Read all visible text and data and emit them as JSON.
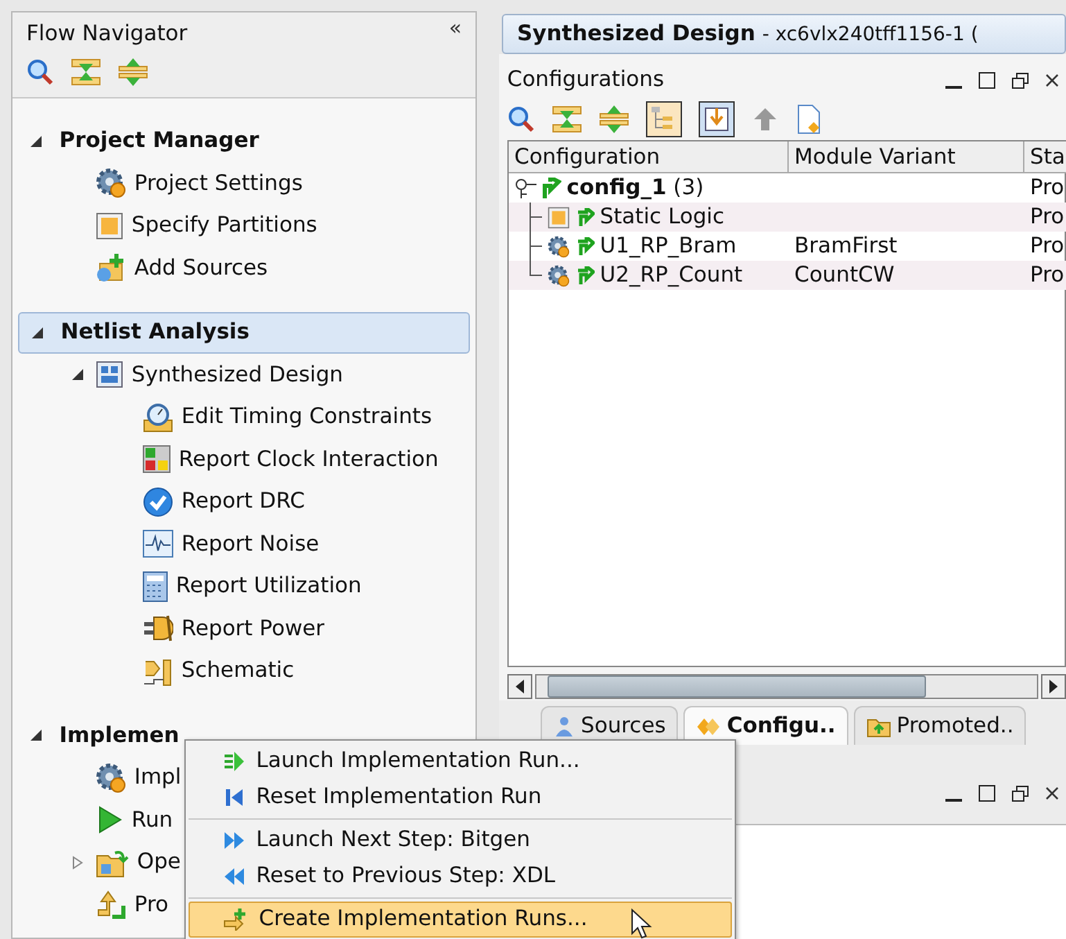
{
  "flow_navigator": {
    "title": "Flow Navigator",
    "collapse_label": "«",
    "sections": [
      {
        "label": "Project Manager",
        "selected": false,
        "expanded": true,
        "children": [
          {
            "label": "Project Settings"
          },
          {
            "label": "Specify Partitions"
          },
          {
            "label": "Add Sources"
          }
        ]
      },
      {
        "label": "Netlist Analysis",
        "selected": true,
        "expanded": true,
        "children": [
          {
            "label": "Synthesized Design",
            "expanded": true,
            "children": [
              {
                "label": "Edit Timing Constraints"
              },
              {
                "label": "Report Clock Interaction"
              },
              {
                "label": "Report DRC"
              },
              {
                "label": "Report Noise"
              },
              {
                "label": "Report Utilization"
              },
              {
                "label": "Report Power"
              },
              {
                "label": "Schematic"
              }
            ]
          }
        ]
      },
      {
        "label": "Implemen",
        "selected": false,
        "expanded": true,
        "children": [
          {
            "label": "Impl"
          },
          {
            "label": "Run"
          },
          {
            "label": "Ope",
            "expanded": false
          },
          {
            "label": "Pro"
          }
        ]
      }
    ]
  },
  "design_title": {
    "name": "Synthesized Design",
    "detail": "- xc6vlx240tff1156-1 ("
  },
  "configurations": {
    "title": "Configurations",
    "columns": [
      "Configuration",
      "Module Variant",
      "Sta"
    ],
    "rows": [
      {
        "configuration": "**config_1** (3)",
        "column_3": "Pro",
        "expanded": true,
        "children": [
          {
            "configuration": "Static Logic",
            "column_3": "Pro"
          },
          {
            "configuration": "U1_RP_Bram",
            "module_variant": "BramFirst",
            "column_3": "Pro"
          },
          {
            "configuration": "U2_RP_Count",
            "module_variant": "CountCW",
            "column_3": "Pro"
          }
        ]
      }
    ]
  },
  "tabs": [
    {
      "label": "Sources",
      "selected": false
    },
    {
      "label": "Configu..",
      "selected": true
    },
    {
      "label": "Promoted..",
      "selected": false
    }
  ],
  "context_menu": {
    "groups": [
      [
        {
          "label": "Launch Implementation Run...",
          "selected": false
        },
        {
          "label": "Reset Implementation Run",
          "selected": false
        }
      ],
      [
        {
          "label": "Launch Next Step: Bitgen",
          "selected": false
        },
        {
          "label": "Reset to Previous Step: XDL",
          "selected": false
        }
      ],
      [
        {
          "label": "Create Implementation Runs...",
          "selected": true
        }
      ]
    ]
  }
}
